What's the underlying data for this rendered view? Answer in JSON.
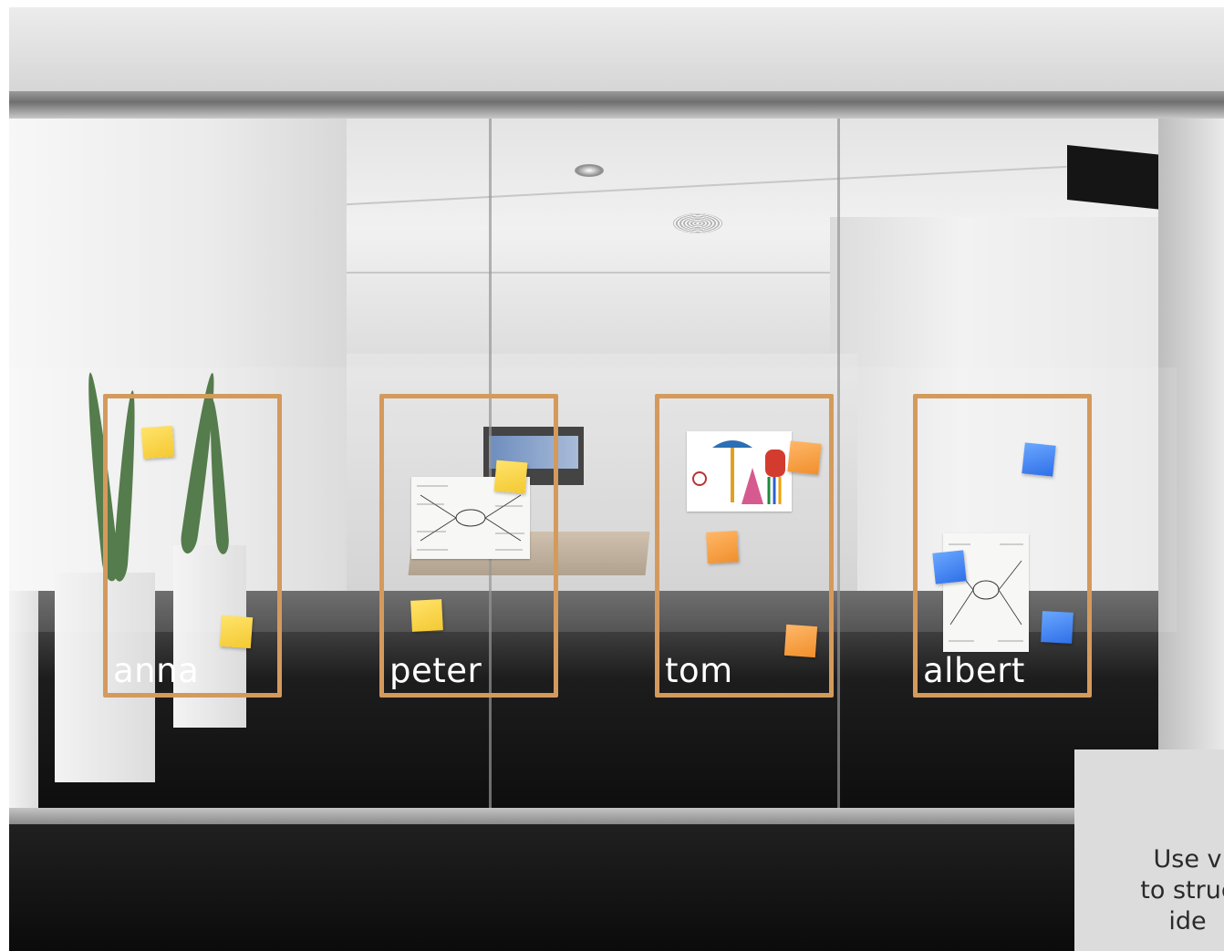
{
  "panels": [
    {
      "name": "anna"
    },
    {
      "name": "peter"
    },
    {
      "name": "tom"
    },
    {
      "name": "albert"
    }
  ],
  "caption": {
    "line1": "Use v",
    "line2": "to struc",
    "line3": "ide"
  },
  "colors": {
    "frame": "#d49a5c",
    "sticky_yellow": "#f4c932",
    "sticky_orange": "#f08f2c",
    "sticky_blue": "#2f6fe8"
  }
}
